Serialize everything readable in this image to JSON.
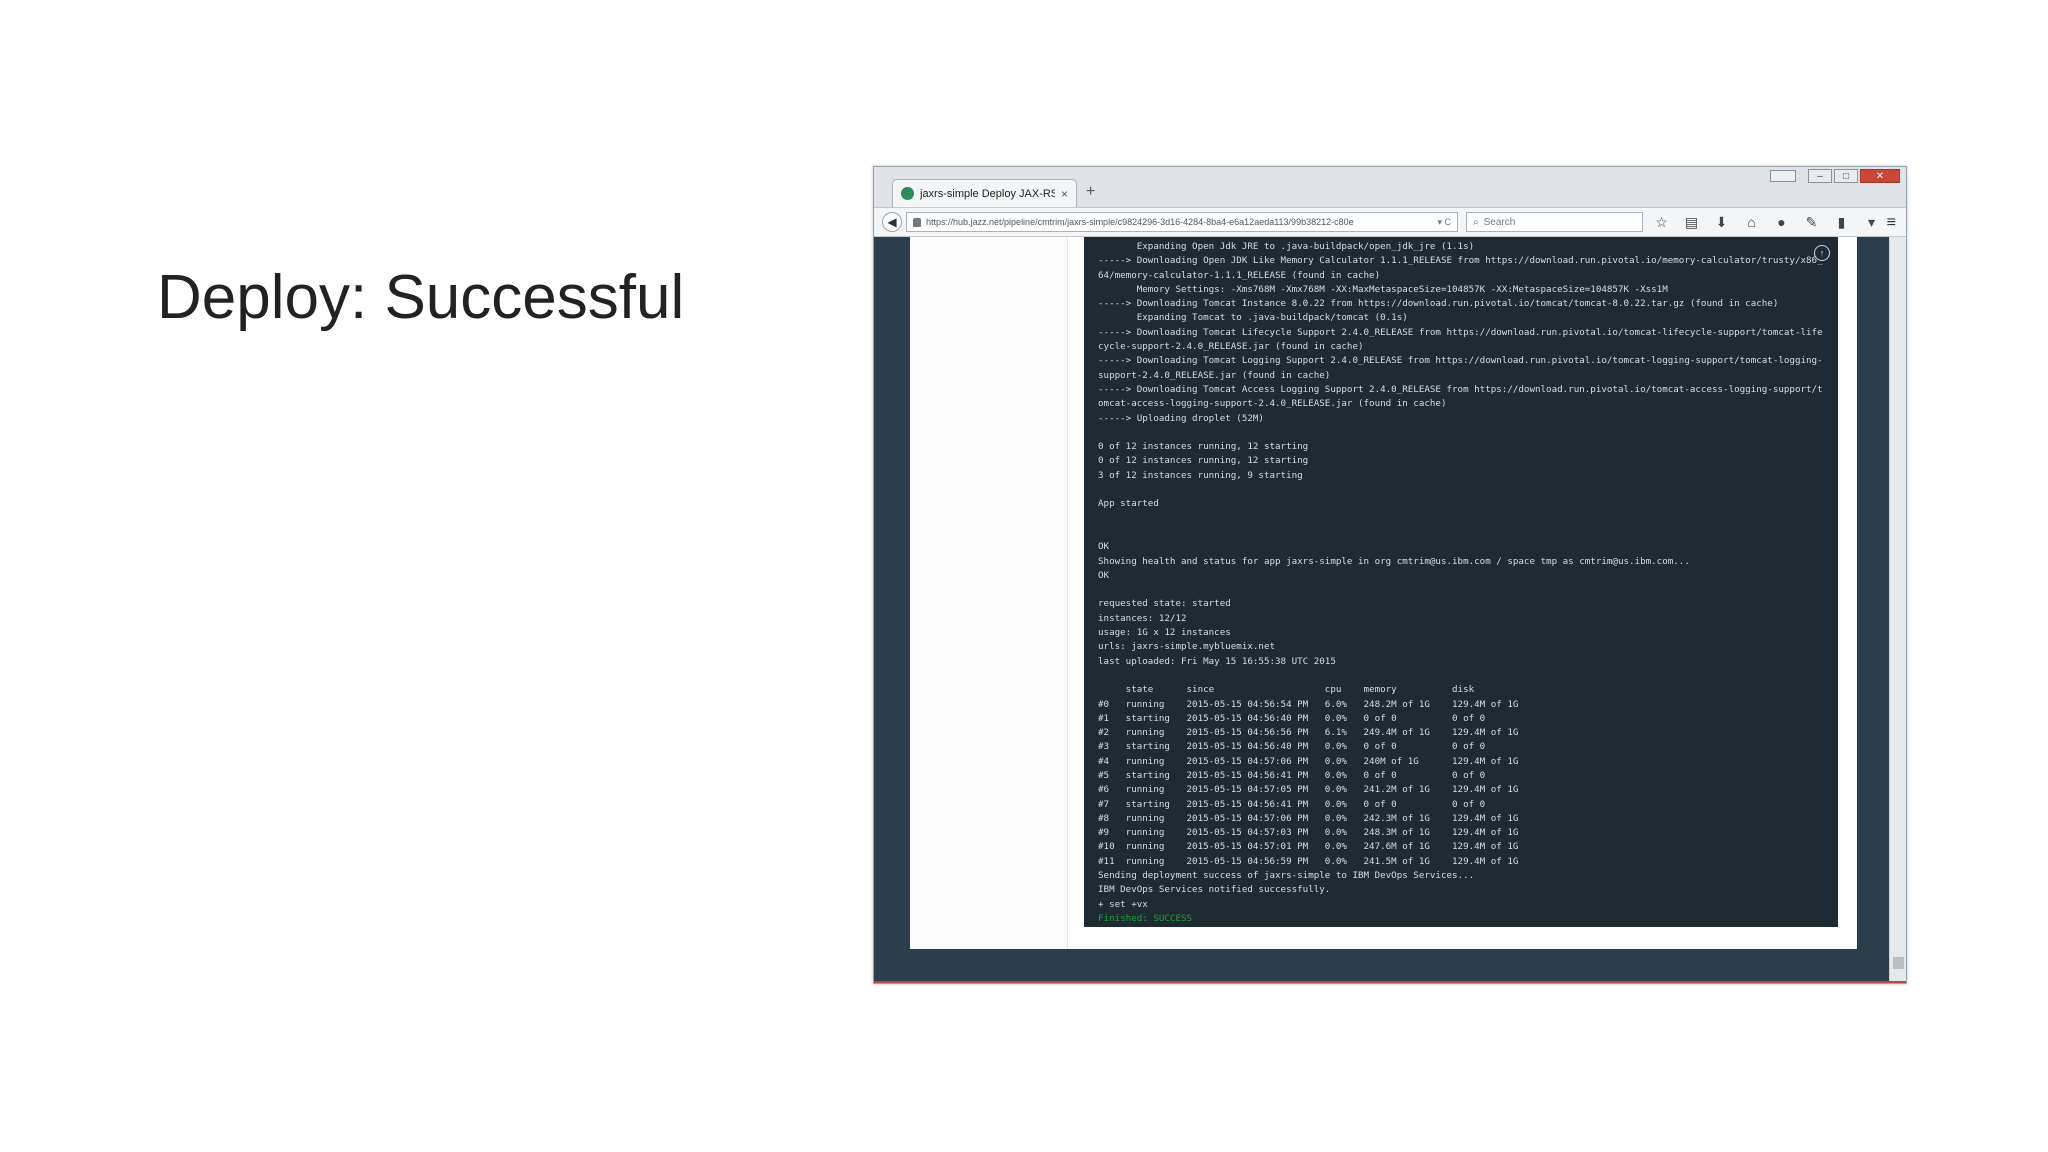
{
  "slide": {
    "title": "Deploy: Successful"
  },
  "browser": {
    "tab": {
      "label": "jaxrs-simple Deploy JAX-RS...",
      "close": "×"
    },
    "new_tab": "+",
    "url": "https://hub.jazz.net/pipeline/cmtrim/jaxrs-simple/c9824296-3d16-4284-8ba4-e6a12aeda113/99b38212-c80e",
    "url_tail": "▾ C",
    "search_placeholder": "Search",
    "toolbar_icons": [
      "☆",
      "▤",
      "⬇",
      "⌂",
      "●",
      "✎",
      "▮",
      "▾"
    ],
    "menu": "≡",
    "window_controls": {
      "minimize": "–",
      "maximize": "□",
      "close": "✕"
    }
  },
  "terminal": {
    "lines": [
      "       Expanding Open Jdk JRE to .java-buildpack/open_jdk_jre (1.1s)",
      "-----> Downloading Open JDK Like Memory Calculator 1.1.1_RELEASE from https://download.run.pivotal.io/memory-calculator/trusty/x86_64/memory-calculator-1.1.1_RELEASE (found in cache)",
      "       Memory Settings: -Xms768M -Xmx768M -XX:MaxMetaspaceSize=104857K -XX:MetaspaceSize=104857K -Xss1M",
      "-----> Downloading Tomcat Instance 8.0.22 from https://download.run.pivotal.io/tomcat/tomcat-8.0.22.tar.gz (found in cache)",
      "       Expanding Tomcat to .java-buildpack/tomcat (0.1s)",
      "-----> Downloading Tomcat Lifecycle Support 2.4.0_RELEASE from https://download.run.pivotal.io/tomcat-lifecycle-support/tomcat-lifecycle-support-2.4.0_RELEASE.jar (found in cache)",
      "-----> Downloading Tomcat Logging Support 2.4.0_RELEASE from https://download.run.pivotal.io/tomcat-logging-support/tomcat-logging-support-2.4.0_RELEASE.jar (found in cache)",
      "-----> Downloading Tomcat Access Logging Support 2.4.0_RELEASE from https://download.run.pivotal.io/tomcat-access-logging-support/tomcat-access-logging-support-2.4.0_RELEASE.jar (found in cache)",
      "-----> Uploading droplet (52M)",
      "",
      "0 of 12 instances running, 12 starting",
      "0 of 12 instances running, 12 starting",
      "3 of 12 instances running, 9 starting",
      "",
      "App started",
      "",
      "",
      "OK",
      "Showing health and status for app jaxrs-simple in org cmtrim@us.ibm.com / space tmp as cmtrim@us.ibm.com...",
      "OK",
      "",
      "requested state: started",
      "instances: 12/12",
      "usage: 1G x 12 instances",
      "urls: jaxrs-simple.mybluemix.net",
      "last uploaded: Fri May 15 16:55:38 UTC 2015",
      "",
      "     state      since                    cpu    memory          disk",
      "#0   running    2015-05-15 04:56:54 PM   6.0%   248.2M of 1G    129.4M of 1G",
      "#1   starting   2015-05-15 04:56:40 PM   0.0%   0 of 0          0 of 0",
      "#2   running    2015-05-15 04:56:56 PM   6.1%   249.4M of 1G    129.4M of 1G",
      "#3   starting   2015-05-15 04:56:40 PM   0.0%   0 of 0          0 of 0",
      "#4   running    2015-05-15 04:57:06 PM   0.0%   240M of 1G      129.4M of 1G",
      "#5   starting   2015-05-15 04:56:41 PM   0.0%   0 of 0          0 of 0",
      "#6   running    2015-05-15 04:57:05 PM   0.0%   241.2M of 1G    129.4M of 1G",
      "#7   starting   2015-05-15 04:56:41 PM   0.0%   0 of 0          0 of 0",
      "#8   running    2015-05-15 04:57:06 PM   0.0%   242.3M of 1G    129.4M of 1G",
      "#9   running    2015-05-15 04:57:03 PM   0.0%   248.3M of 1G    129.4M of 1G",
      "#10  running    2015-05-15 04:57:01 PM   0.0%   247.6M of 1G    129.4M of 1G",
      "#11  running    2015-05-15 04:56:59 PM   0.0%   241.5M of 1G    129.4M of 1G",
      "Sending deployment success of jaxrs-simple to IBM DevOps Services...",
      "IBM DevOps Services notified successfully.",
      "+ set +vx"
    ],
    "status": "Finished: SUCCESS",
    "scroll_top_icon": "↑"
  },
  "colors": {
    "terminal_bg": "#1f2b33",
    "success": "#1fa33a",
    "page_bg": "#2c3e4c"
  }
}
